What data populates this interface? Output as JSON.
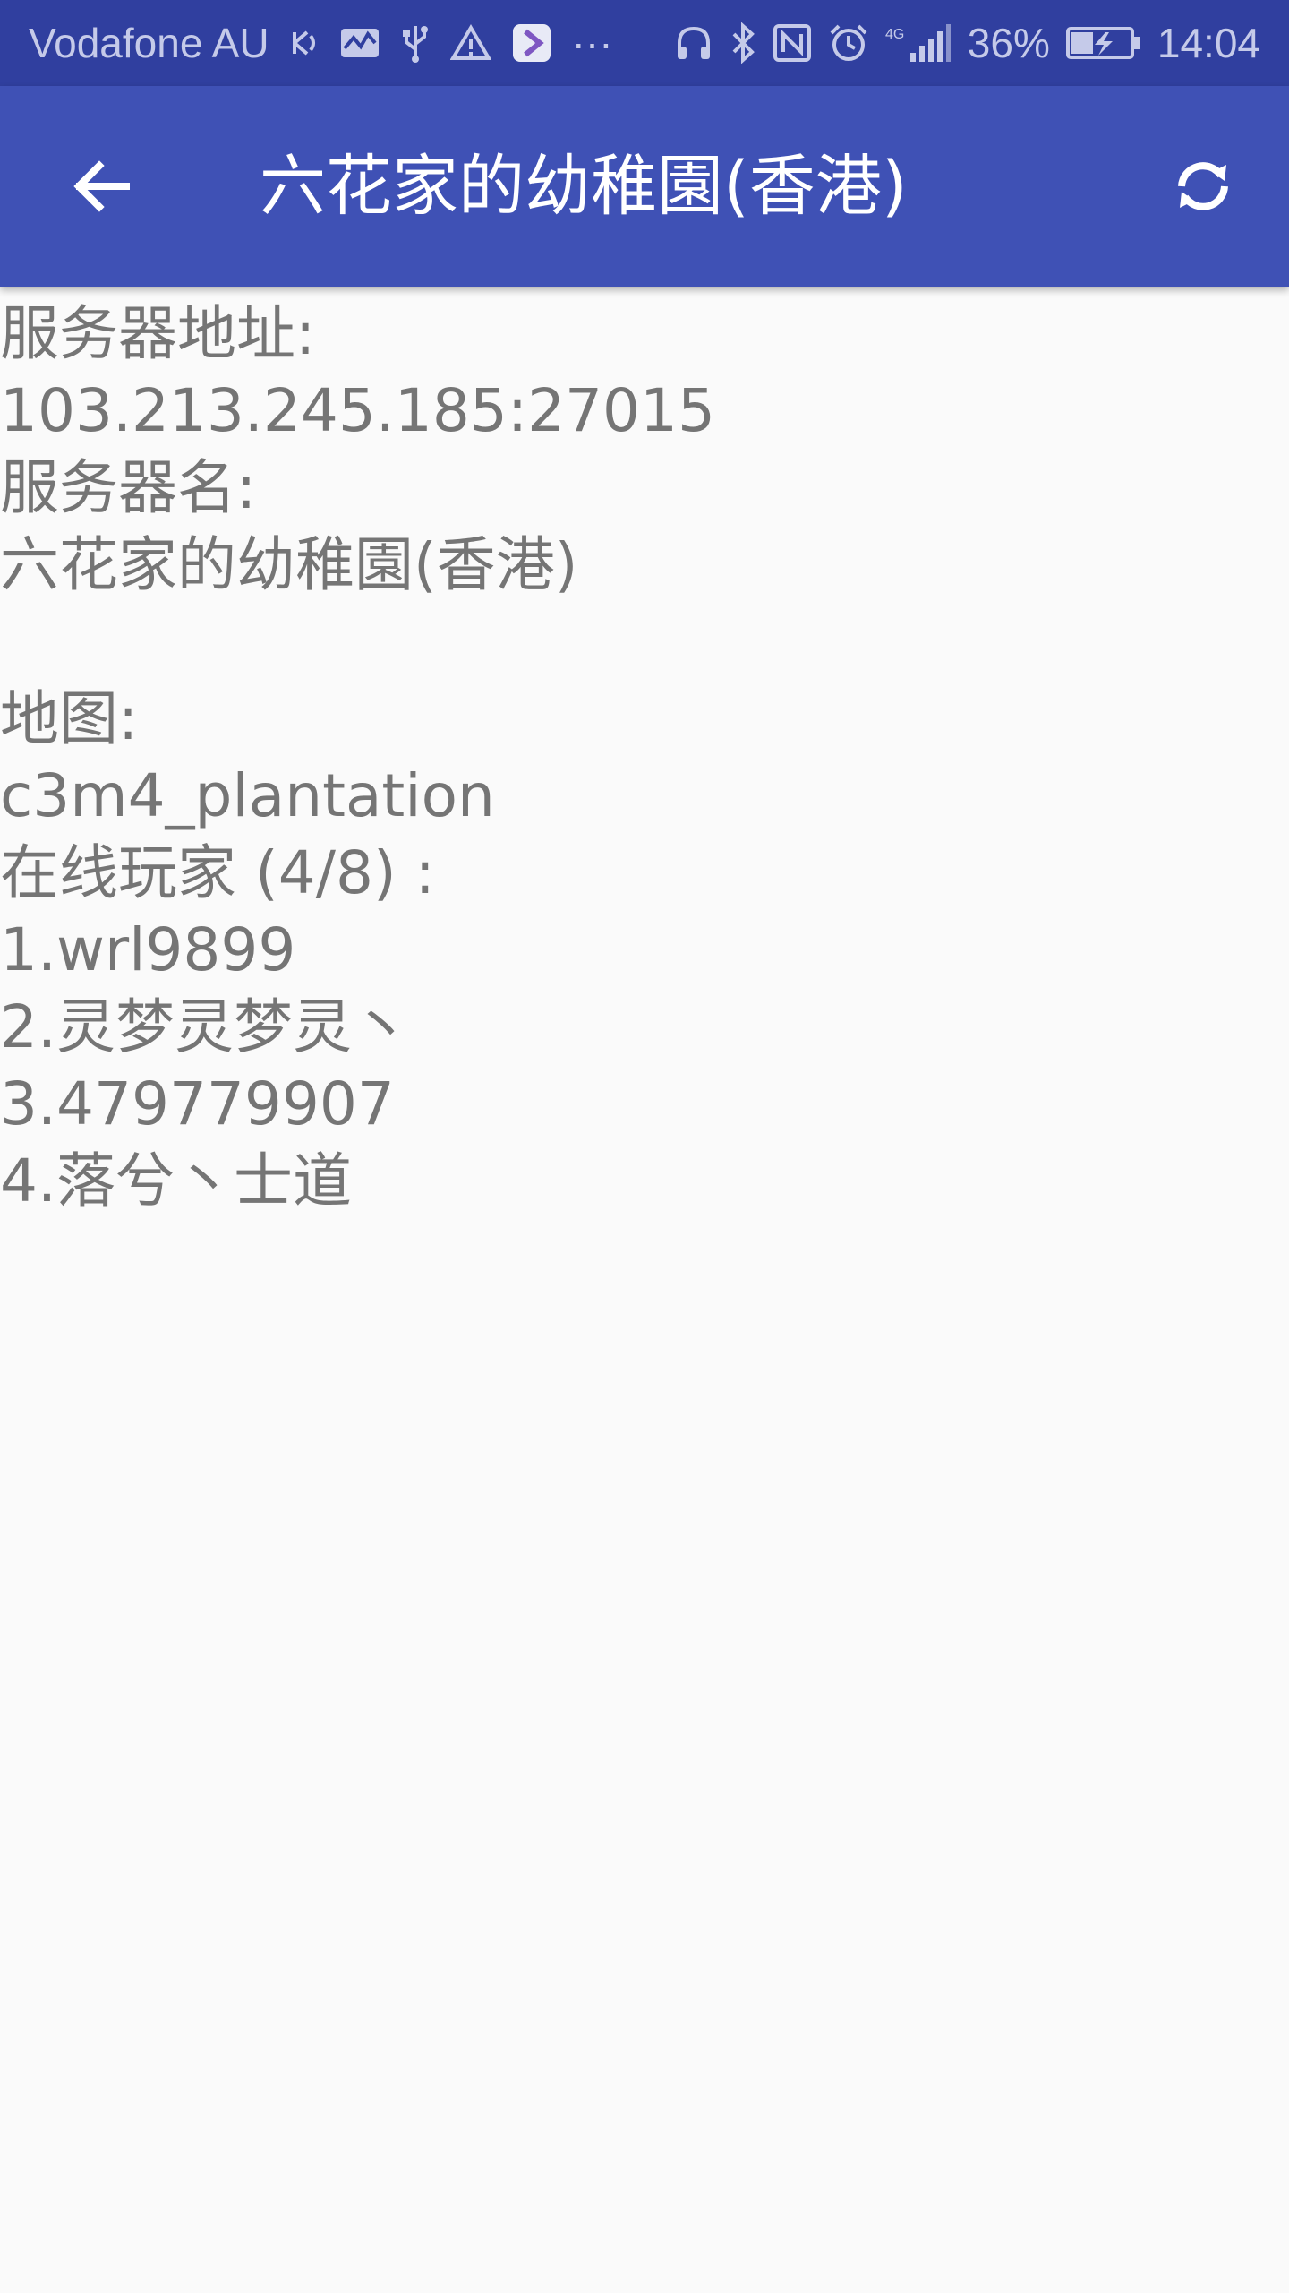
{
  "status_bar": {
    "carrier": "Vodafone AU",
    "more": "···",
    "battery_percent": "36%",
    "time": "14:04",
    "network": "4G",
    "icons_left": [
      "signal-relay-icon",
      "pulse-icon",
      "usb-icon",
      "warning-icon",
      "app-notification-icon"
    ],
    "icons_right": [
      "headphones-icon",
      "bluetooth-icon",
      "nfc-icon",
      "alarm-icon",
      "cell-signal-icon",
      "battery-charging-icon"
    ]
  },
  "app_bar": {
    "title": "六花家的幼稚園(香港)",
    "color": "#3f51b5",
    "status_color": "#303f9f"
  },
  "server_info": {
    "address_label": "服务器地址:",
    "address_value": "103.213.245.185:27015",
    "name_label": "服务器名:",
    "name_value": "六花家的幼稚園(香港)",
    "map_label": "地图:",
    "map_value": "c3m4_plantation",
    "players_label": "在线玩家 (4/8) :",
    "players": [
      "1.wrl9899",
      "2.灵梦灵梦灵丶",
      "3.479779907",
      "4.落兮丶士道"
    ]
  }
}
